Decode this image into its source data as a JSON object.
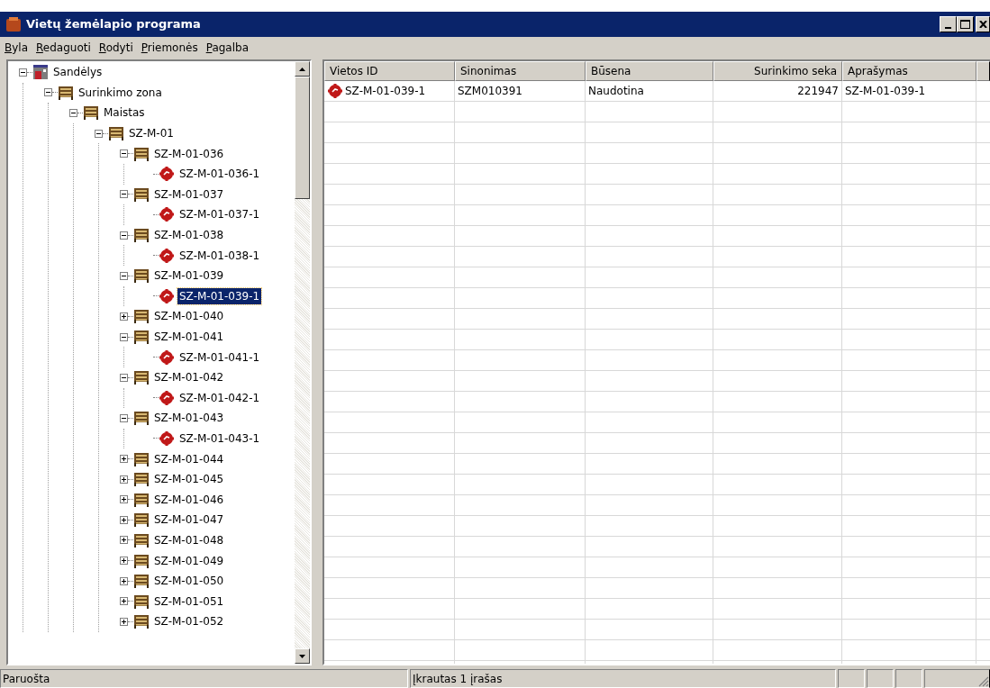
{
  "window": {
    "title": "Vietų žemėlapio programa"
  },
  "menu": [
    {
      "label": "Byla"
    },
    {
      "label": "Redaguoti"
    },
    {
      "label": "Rodyti"
    },
    {
      "label": "Priemonės"
    },
    {
      "label": "Pagalba"
    }
  ],
  "tree": [
    {
      "label": "Sandėlys",
      "kind": "warehouse",
      "expanded": true,
      "selected": false,
      "children": [
        {
          "label": "Surinkimo zona",
          "kind": "rack",
          "expanded": true,
          "selected": false,
          "children": [
            {
              "label": "Maistas",
              "kind": "rack",
              "expanded": true,
              "selected": false,
              "children": [
                {
                  "label": "SZ-M-01",
                  "kind": "rack",
                  "expanded": true,
                  "selected": false,
                  "children": [
                    {
                      "label": "SZ-M-01-036",
                      "kind": "rack",
                      "expanded": true,
                      "selected": false,
                      "children": [
                        {
                          "label": "SZ-M-01-036-1",
                          "kind": "slot",
                          "selected": false
                        }
                      ]
                    },
                    {
                      "label": "SZ-M-01-037",
                      "kind": "rack",
                      "expanded": true,
                      "selected": false,
                      "children": [
                        {
                          "label": "SZ-M-01-037-1",
                          "kind": "slot",
                          "selected": false
                        }
                      ]
                    },
                    {
                      "label": "SZ-M-01-038",
                      "kind": "rack",
                      "expanded": true,
                      "selected": false,
                      "children": [
                        {
                          "label": "SZ-M-01-038-1",
                          "kind": "slot",
                          "selected": false
                        }
                      ]
                    },
                    {
                      "label": "SZ-M-01-039",
                      "kind": "rack",
                      "expanded": true,
                      "selected": false,
                      "children": [
                        {
                          "label": "SZ-M-01-039-1",
                          "kind": "slot",
                          "selected": true
                        }
                      ]
                    },
                    {
                      "label": "SZ-M-01-040",
                      "kind": "rack",
                      "expanded": false,
                      "selected": false
                    },
                    {
                      "label": "SZ-M-01-041",
                      "kind": "rack",
                      "expanded": true,
                      "selected": false,
                      "children": [
                        {
                          "label": "SZ-M-01-041-1",
                          "kind": "slot",
                          "selected": false
                        }
                      ]
                    },
                    {
                      "label": "SZ-M-01-042",
                      "kind": "rack",
                      "expanded": true,
                      "selected": false,
                      "children": [
                        {
                          "label": "SZ-M-01-042-1",
                          "kind": "slot",
                          "selected": false
                        }
                      ]
                    },
                    {
                      "label": "SZ-M-01-043",
                      "kind": "rack",
                      "expanded": true,
                      "selected": false,
                      "children": [
                        {
                          "label": "SZ-M-01-043-1",
                          "kind": "slot",
                          "selected": false
                        }
                      ]
                    },
                    {
                      "label": "SZ-M-01-044",
                      "kind": "rack",
                      "expanded": false,
                      "selected": false
                    },
                    {
                      "label": "SZ-M-01-045",
                      "kind": "rack",
                      "expanded": false,
                      "selected": false
                    },
                    {
                      "label": "SZ-M-01-046",
                      "kind": "rack",
                      "expanded": false,
                      "selected": false
                    },
                    {
                      "label": "SZ-M-01-047",
                      "kind": "rack",
                      "expanded": false,
                      "selected": false
                    },
                    {
                      "label": "SZ-M-01-048",
                      "kind": "rack",
                      "expanded": false,
                      "selected": false
                    },
                    {
                      "label": "SZ-M-01-049",
                      "kind": "rack",
                      "expanded": false,
                      "selected": false
                    },
                    {
                      "label": "SZ-M-01-050",
                      "kind": "rack",
                      "expanded": false,
                      "selected": false
                    },
                    {
                      "label": "SZ-M-01-051",
                      "kind": "rack",
                      "expanded": false,
                      "selected": false
                    },
                    {
                      "label": "SZ-M-01-052",
                      "kind": "rack",
                      "expanded": false,
                      "selected": false
                    }
                  ]
                }
              ]
            }
          ]
        }
      ]
    }
  ],
  "table": {
    "columns": [
      {
        "label": "Vietos ID",
        "kind": "text"
      },
      {
        "label": "Sinonimas",
        "kind": "text"
      },
      {
        "label": "Būsena",
        "kind": "text"
      },
      {
        "label": "Surinkimo seka",
        "kind": "number"
      },
      {
        "label": "Aprašymas",
        "kind": "text"
      }
    ],
    "rows": [
      {
        "kind": "slot",
        "cells": [
          "SZ-M-01-039-1",
          "SZM010391",
          "Naudotina",
          "221947",
          "SZ-M-01-039-1"
        ]
      }
    ]
  },
  "status_bar": [
    "Paruošta",
    "Įkrautas 1 įrašas"
  ]
}
